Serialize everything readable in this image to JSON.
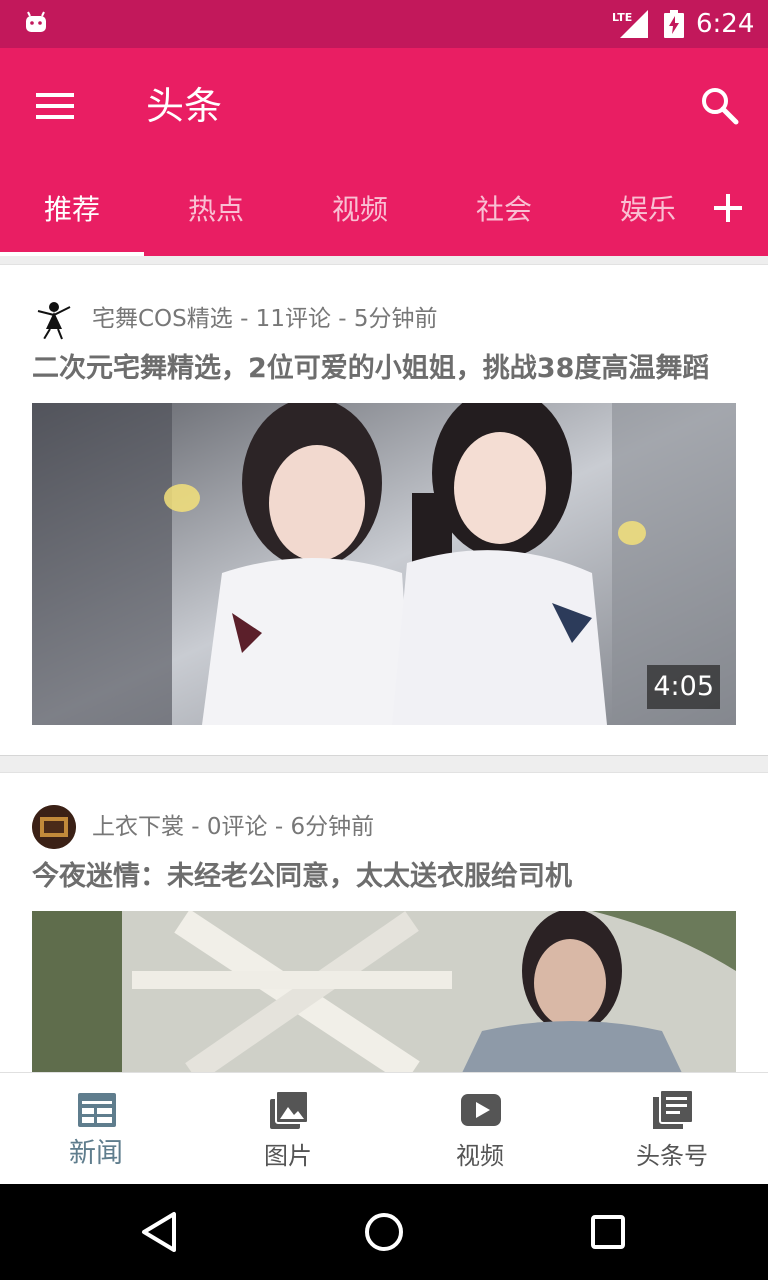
{
  "status_bar": {
    "network": "LTE",
    "time": "6:24"
  },
  "app_bar": {
    "title": "头条",
    "menu_icon": "menu-icon",
    "search_icon": "search-icon"
  },
  "tabs": [
    {
      "label": "推荐",
      "active": true
    },
    {
      "label": "热点",
      "active": false
    },
    {
      "label": "视频",
      "active": false
    },
    {
      "label": "社会",
      "active": false
    },
    {
      "label": "娱乐",
      "active": false
    }
  ],
  "add_tab_icon": "plus-icon",
  "feed": [
    {
      "meta": "宅舞COS精选 - 11评论 - 5分钟前",
      "title": "二次元宅舞精选，2位可爱的小姐姐，挑战38度高温舞蹈",
      "duration": "4:05"
    },
    {
      "meta": "上衣下裳 - 0评论 - 6分钟前",
      "title": "今夜迷情：未经老公同意，太太送衣服给司机"
    }
  ],
  "bottom_nav": [
    {
      "label": "新闻",
      "icon": "news-icon",
      "active": true
    },
    {
      "label": "图片",
      "icon": "photos-icon",
      "active": false
    },
    {
      "label": "视频",
      "icon": "video-play-icon",
      "active": false
    },
    {
      "label": "头条号",
      "icon": "articles-icon",
      "active": false
    }
  ],
  "colors": {
    "status_bar": "#c2185b",
    "app_bar": "#e91e63",
    "active_nav": "#5f7d8d"
  }
}
